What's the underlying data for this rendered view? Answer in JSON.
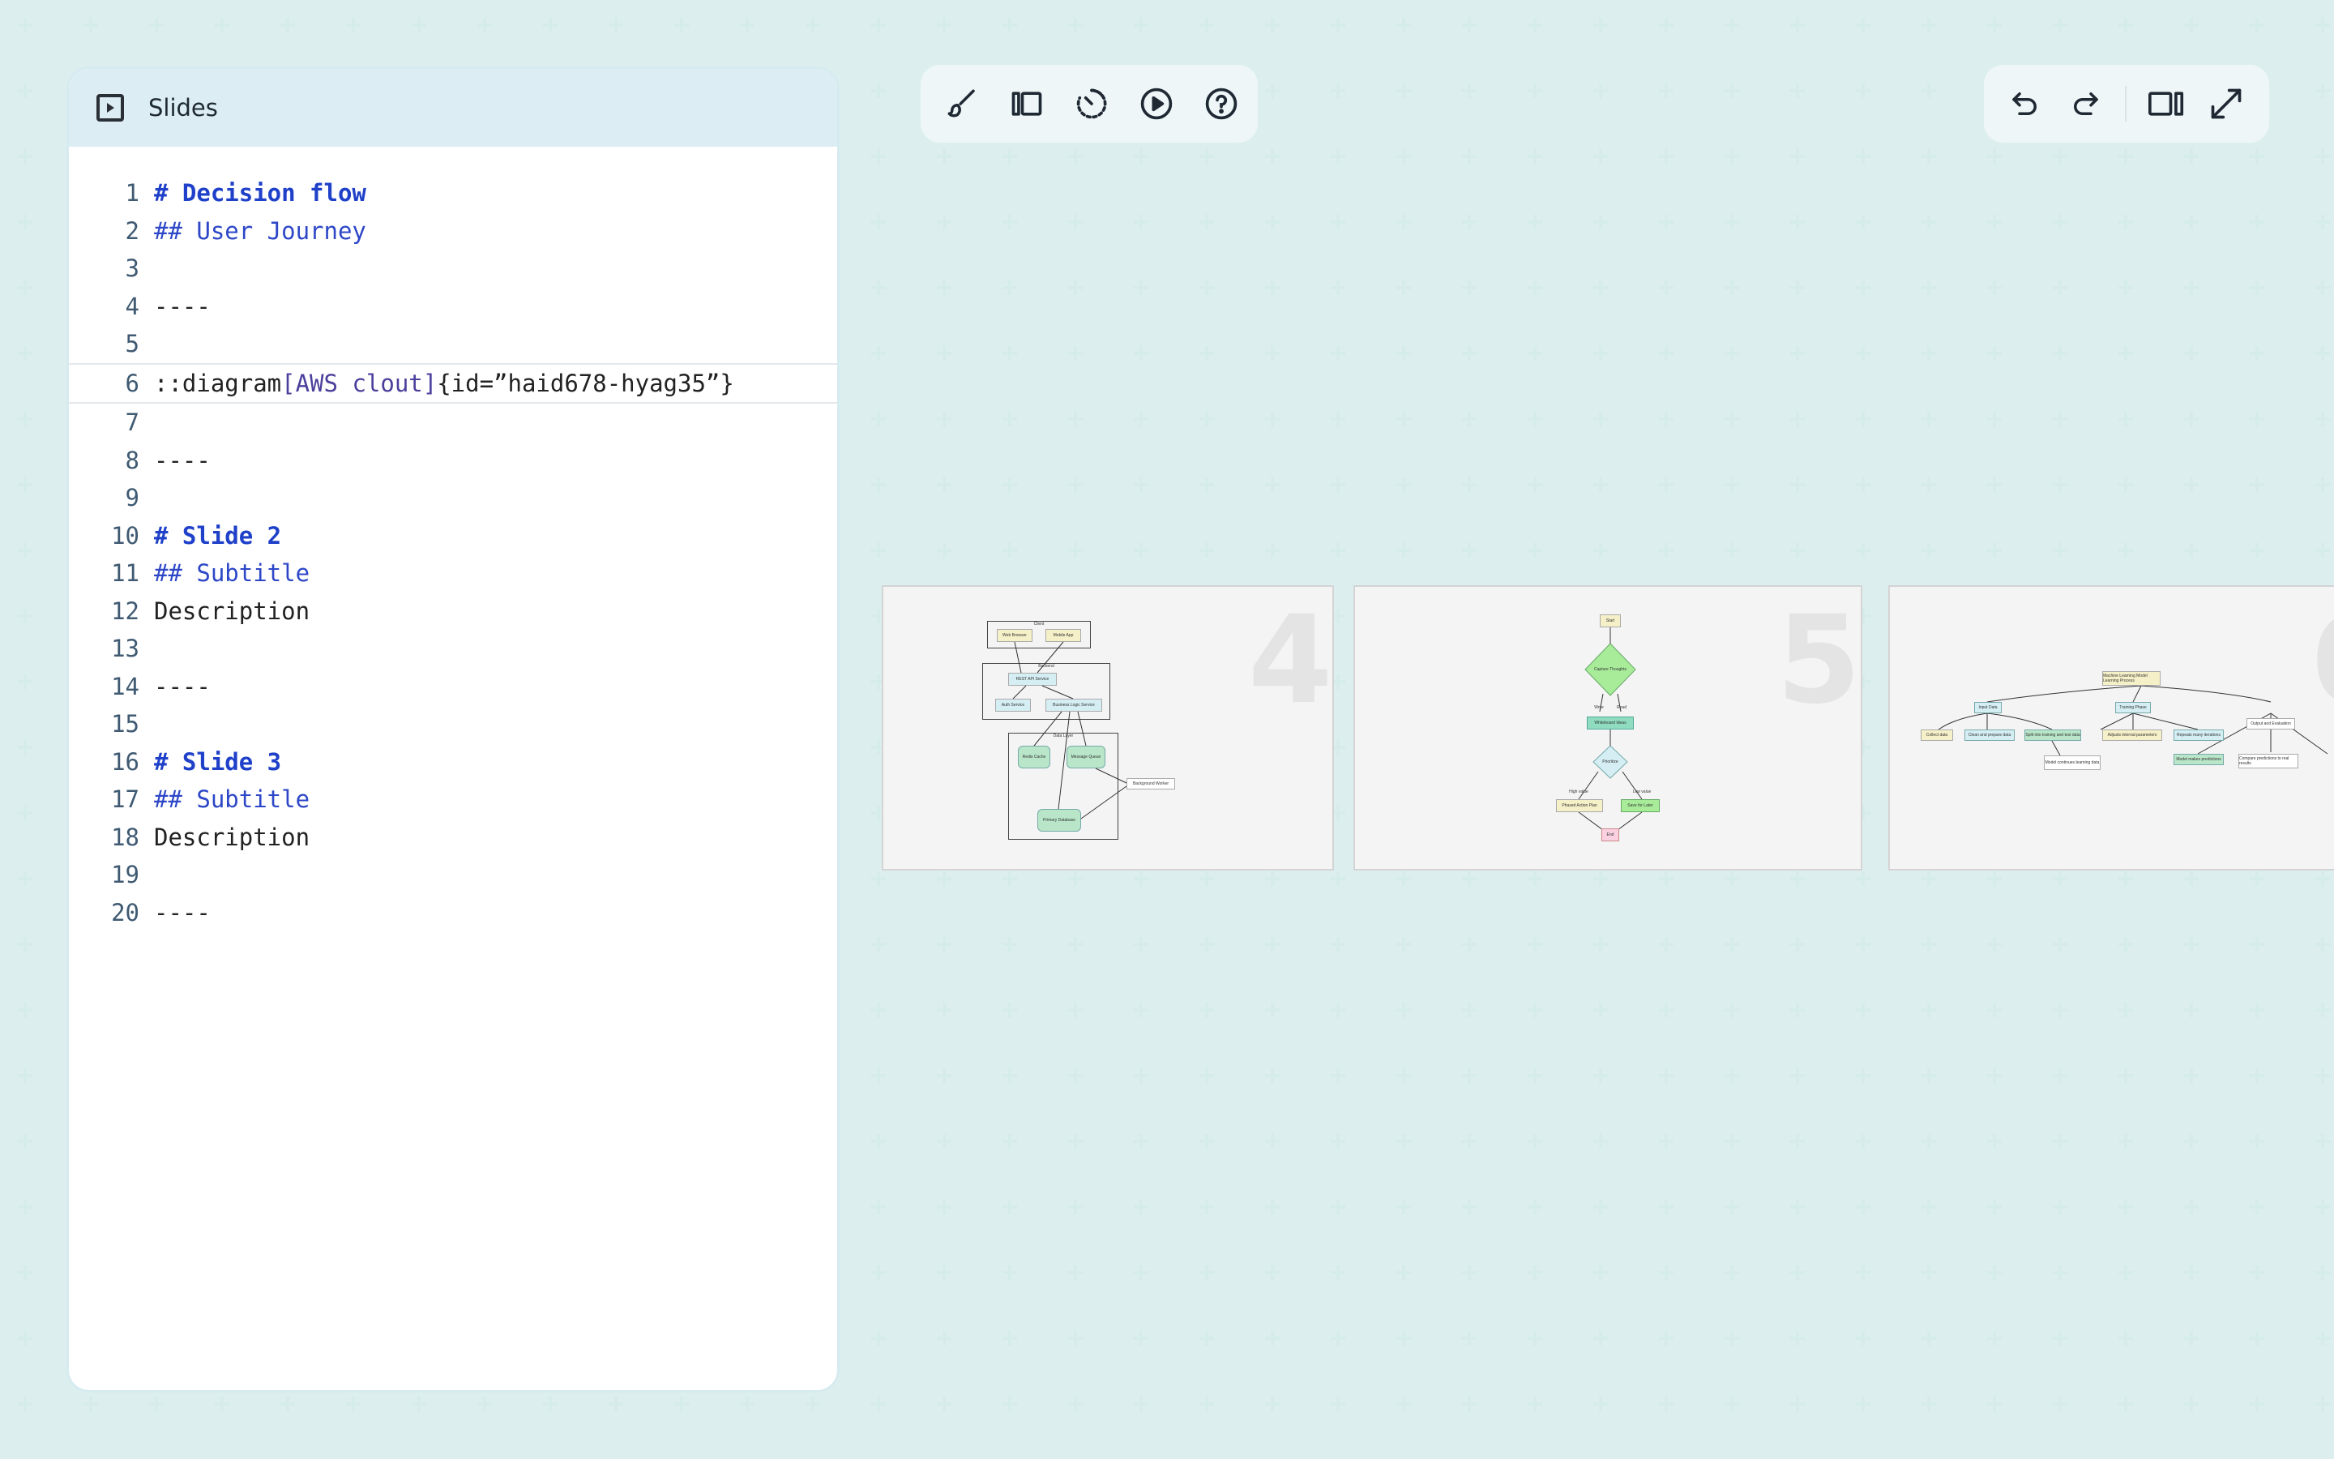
{
  "editor": {
    "title": "Slides",
    "lines": [
      {
        "n": "1",
        "segments": [
          {
            "t": "# Decision flow",
            "c": "h1"
          }
        ]
      },
      {
        "n": "2",
        "segments": [
          {
            "t": "## User Journey",
            "c": "h2"
          }
        ]
      },
      {
        "n": "3",
        "segments": []
      },
      {
        "n": "4",
        "segments": [
          {
            "t": "----",
            "c": "plain"
          }
        ]
      },
      {
        "n": "5",
        "segments": []
      },
      {
        "n": "6",
        "segments": [
          {
            "t": "::diagram",
            "c": "plain"
          },
          {
            "t": "[AWS clout]",
            "c": "br"
          },
          {
            "t": "{id=”haid678-hyag35”}",
            "c": "plain"
          }
        ]
      },
      {
        "n": "7",
        "segments": []
      },
      {
        "n": "8",
        "segments": [
          {
            "t": "----",
            "c": "plain"
          }
        ]
      },
      {
        "n": "9",
        "segments": []
      },
      {
        "n": "10",
        "segments": [
          {
            "t": "# Slide 2",
            "c": "h1"
          }
        ]
      },
      {
        "n": "11",
        "segments": [
          {
            "t": "## Subtitle",
            "c": "h2"
          }
        ]
      },
      {
        "n": "12",
        "segments": [
          {
            "t": "Description",
            "c": "plain"
          }
        ]
      },
      {
        "n": "13",
        "segments": []
      },
      {
        "n": "14",
        "segments": [
          {
            "t": "----",
            "c": "plain"
          }
        ]
      },
      {
        "n": "15",
        "segments": []
      },
      {
        "n": "16",
        "segments": [
          {
            "t": "# Slide 3",
            "c": "h1"
          }
        ]
      },
      {
        "n": "17",
        "segments": [
          {
            "t": "## Subtitle",
            "c": "h2"
          }
        ]
      },
      {
        "n": "18",
        "segments": [
          {
            "t": "Description",
            "c": "plain"
          }
        ]
      },
      {
        "n": "19",
        "segments": []
      },
      {
        "n": "20",
        "segments": [
          {
            "t": "----",
            "c": "plain"
          }
        ]
      }
    ],
    "active_line": "6"
  },
  "toolbar_left": [
    "brush-icon",
    "sidebar-toggle-icon",
    "timer-icon",
    "play-icon",
    "help-icon"
  ],
  "toolbar_right": [
    "undo-icon",
    "redo-icon",
    "split-view-icon",
    "fullscreen-icon"
  ],
  "slides": [
    {
      "number": "4",
      "type": "architecture",
      "labels": [
        "Client",
        "Web Browser",
        "Mobile App",
        "Backend",
        "REST API Service",
        "Auth Service",
        "Business Logic Service",
        "Data Layer",
        "Redis Cache",
        "Message Queue",
        "Background Worker",
        "Primary Database"
      ]
    },
    {
      "number": "5",
      "type": "flowchart",
      "labels": [
        "Start",
        "Capture Thoughts",
        "Write",
        "Read",
        "Whiteboard Ideas",
        "Prioritize",
        "High value",
        "Low value",
        "Phased Action Plan",
        "Save for Later",
        "End"
      ]
    },
    {
      "number": "6",
      "type": "tree",
      "labels": [
        "Machine Learning Model Learning Process",
        "Input Data",
        "Training Phase",
        "Output and Evaluation",
        "Collect data",
        "Clean and prepare data",
        "Split into training and test data",
        "Model continues learning data",
        "Adjusts internal parameters",
        "Repeats many iterations",
        "Model makes predictions",
        "Compare predictions to real results"
      ]
    }
  ],
  "colors": {
    "accent": "#1f40c9",
    "panel_header": "#dceef3",
    "node_green": "#b9e6c9",
    "node_yellow": "#f5f0c8"
  }
}
